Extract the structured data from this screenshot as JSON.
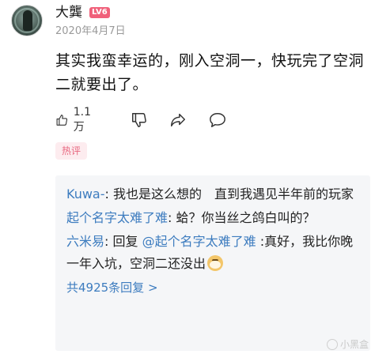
{
  "user": {
    "name": "大龔",
    "level": "LV6",
    "date": "2020年4月7日"
  },
  "post": {
    "text": "其实我蛮幸运的，刚入空洞一，快玩完了空洞二就要出了。"
  },
  "actions": {
    "like_count": "1.1万"
  },
  "tag": {
    "label": "热评"
  },
  "replies": [
    {
      "name": "Kuwa-",
      "sep": ":",
      "text": " 我也是这么想的　直到我遇见半年前的玩家"
    },
    {
      "name": "起个名字太难了难",
      "sep": ":",
      "text": " 蛤？你当丝之鸽白叫的？"
    },
    {
      "name": "六米易",
      "sep": ":",
      "pre": " 回复 ",
      "mention": "@起个名字太难了难",
      "text": " :真好，我比你晚一年入坑，空洞二还没出"
    }
  ],
  "more_replies": {
    "label": "共4925条回复 >"
  },
  "watermark": {
    "text": "小黑盒"
  },
  "colors": {
    "reply_name": "#3d7cbf",
    "badge": "#f0607a",
    "tag_bg": "#fdecef",
    "tag_text": "#e8677f"
  }
}
